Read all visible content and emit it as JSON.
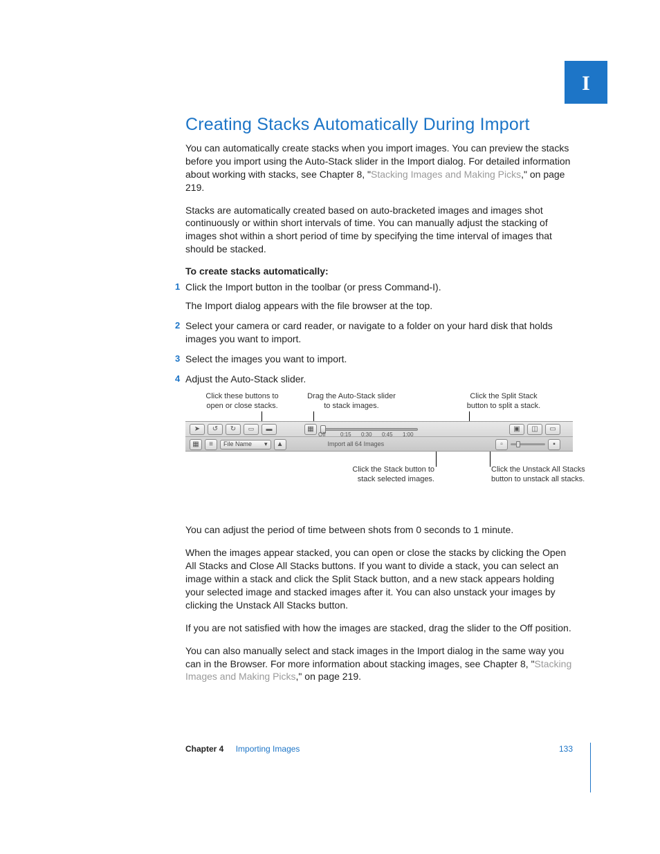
{
  "tab_marker": "I",
  "heading": "Creating Stacks Automatically During Import",
  "para1_a": "You can automatically create stacks when you import images. You can preview the stacks before you import using the Auto-Stack slider in the Import dialog. For detailed information about working with stacks, see Chapter 8, \"",
  "para1_link": "Stacking Images and Making Picks",
  "para1_b": ",\" on page 219.",
  "para2": "Stacks are automatically created based on auto-bracketed images and images shot continuously or within short intervals of time. You can manually adjust the stacking of images shot within a short period of time by specifying the time interval of images that should be stacked.",
  "steps_heading": "To create stacks automatically:",
  "steps": [
    {
      "num": "1",
      "text": "Click the Import button in the toolbar (or press Command-I).",
      "sub": "The Import dialog appears with the file browser at the top."
    },
    {
      "num": "2",
      "text": "Select your camera or card reader, or navigate to a folder on your hard disk that holds images you want to import.",
      "sub": ""
    },
    {
      "num": "3",
      "text": "Select the images you want to import.",
      "sub": ""
    },
    {
      "num": "4",
      "text": "Adjust the Auto-Stack slider.",
      "sub": ""
    }
  ],
  "callouts": {
    "open_close": "Click these buttons to open or close stacks.",
    "drag_slider": "Drag the Auto-Stack slider to stack images.",
    "split_stack": "Click the Split Stack button to split a stack.",
    "stack_button": "Click the Stack button to stack selected images.",
    "unstack_all": "Click the Unstack All Stacks button to unstack all stacks."
  },
  "toolbar": {
    "ticks": [
      "Off",
      "0:15",
      "0:30",
      "0:45",
      "1:00"
    ],
    "file_name_label": "File Name",
    "import_text": "Import all 64 Images",
    "sort_arrow": "▲",
    "dd_arrows": "▾"
  },
  "para3": "You can adjust the period of time between shots from 0 seconds to 1 minute.",
  "para4": "When the images appear stacked, you can open or close the stacks by clicking the Open All Stacks and Close All Stacks buttons. If you want to divide a stack, you can select an image within a stack and click the Split Stack button, and a new stack appears holding your selected image and stacked images after it. You can also unstack your images by clicking the Unstack All Stacks button.",
  "para5": "If you are not satisfied with how the images are stacked, drag the slider to the Off position.",
  "para6_a": "You can also manually select and stack images in the Import dialog in the same way you can in the Browser. For more information about stacking images, see Chapter 8, \"",
  "para6_link": "Stacking Images and Making Picks",
  "para6_b": ",\" on page 219.",
  "footer": {
    "chapter_label": "Chapter 4",
    "chapter_name": "Importing Images",
    "page_number": "133"
  }
}
